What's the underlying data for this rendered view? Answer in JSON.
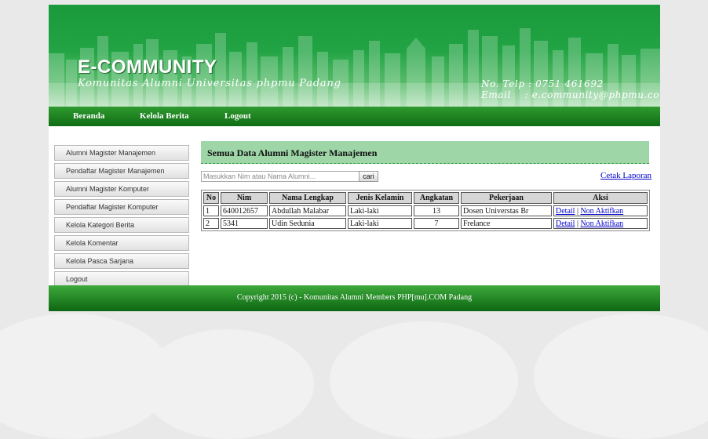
{
  "header": {
    "title": "E-COMMUNITY",
    "subtitle": "Komunitas Alumni Universitas phpmu Padang",
    "phone": "No. Telp : 0751 461692",
    "email": "Email    : e.community@phpmu.com"
  },
  "nav": {
    "items": [
      "Beranda",
      "Kelola Berita",
      "Logout"
    ]
  },
  "sidebar": {
    "items": [
      "Alumni Magister Manajemen",
      "Pendaftar Magister Manajemen",
      "Alumni Magister Komputer",
      "Pendaftar Magister Komputer",
      "Kelola Kategori Berita",
      "Kelola Komentar",
      "Kelola Pasca Sarjana",
      "Logout"
    ]
  },
  "main": {
    "title": "Semua Data Alumni Magister Manajemen",
    "search_placeholder": "Masukkan Nim atau Nama Alumni...",
    "search_button": "cari",
    "print_link": "Cetak Laporan",
    "table": {
      "headers": [
        "No",
        "Nim",
        "Nama Lengkap",
        "Jenis Kelamin",
        "Angkatan",
        "Pekerjaan",
        "Aksi"
      ],
      "rows": [
        {
          "no": "1",
          "nim": "640012657",
          "nama": "Abdullah Malabar",
          "jk": "Laki-laki",
          "angkatan": "13",
          "pekerjaan": "Dosen Universtas Br",
          "detail": "Detail",
          "sep": "|",
          "nonaktif": "Non Aktifkan"
        },
        {
          "no": "2",
          "nim": "5341",
          "nama": "Udin Sedunia",
          "jk": "Laki-laki",
          "angkatan": "7",
          "pekerjaan": "Frelance",
          "detail": "Detail",
          "sep": "|",
          "nonaktif": "Non Aktifkan"
        }
      ]
    }
  },
  "footer": {
    "text": "Copyright 2015 (c) - Komunitas Alumni Members PHP[mu].COM Padang"
  },
  "colors": {
    "header_green": "#22a444",
    "nav_green": "#0f6d14",
    "title_bar": "#9fd6a8",
    "link": "#0000cc"
  }
}
